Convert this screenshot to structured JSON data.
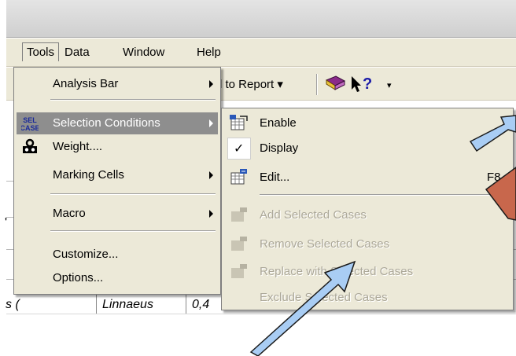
{
  "menubar": {
    "tools": "Tools",
    "data": "Data",
    "window": "Window",
    "help": "Help"
  },
  "toolbar": {
    "report_button": "l to Report ▾",
    "help_dropdown": "▾"
  },
  "grid": {
    "row_prefix": "s (",
    "author": "Linnaeus",
    "value": "0,4",
    "partial_char": "'"
  },
  "tools_menu": {
    "items": [
      {
        "label": "Analysis Bar",
        "has_submenu": true,
        "icon": "none"
      },
      {
        "label": "Selection Conditions",
        "has_submenu": true,
        "icon": "sel-case-icon",
        "highlighted": true
      },
      {
        "label": "Weight....",
        "has_submenu": false,
        "icon": "weight-icon"
      },
      {
        "label": "Marking Cells",
        "has_submenu": true,
        "icon": "none"
      },
      {
        "label": "Macro",
        "has_submenu": true,
        "icon": "none"
      },
      {
        "label": "Customize...",
        "has_submenu": false,
        "icon": "none"
      },
      {
        "label": "Options...",
        "has_submenu": false,
        "icon": "none"
      }
    ],
    "sel_icon_text": "SEL CASE"
  },
  "selection_submenu": {
    "items": [
      {
        "label": "Enable",
        "enabled": true,
        "icon": "enable-icon"
      },
      {
        "label": "Display",
        "enabled": true,
        "checked": true,
        "check_mark": "✓"
      },
      {
        "label": "Edit...",
        "enabled": true,
        "shortcut": "F8",
        "icon": "edit-icon"
      },
      {
        "label": "Add Selected Cases",
        "enabled": false,
        "icon": "add-cases-icon"
      },
      {
        "label": "Remove Selected Cases",
        "enabled": false,
        "icon": "remove-cases-icon"
      },
      {
        "label": "Replace with Selected Cases",
        "enabled": false,
        "icon": "replace-cases-icon"
      },
      {
        "label": "Exclude Selected Cases",
        "enabled": false,
        "icon": "none"
      }
    ]
  },
  "annotations": {
    "arrow_color": "#a9cdf4",
    "arrow_stroke": "#1a1a1a",
    "marker_color": "#c8674c"
  }
}
